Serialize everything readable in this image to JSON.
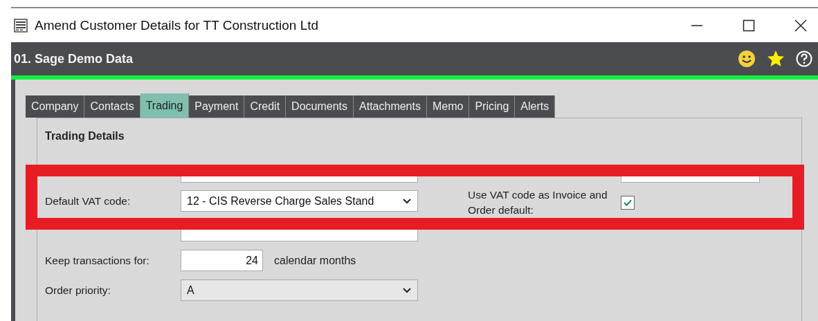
{
  "window": {
    "title": "Amend Customer Details for TT Construction Ltd"
  },
  "header": {
    "company": "01. Sage Demo Data"
  },
  "tabs": [
    {
      "label": "Company",
      "selected": false
    },
    {
      "label": "Contacts",
      "selected": false
    },
    {
      "label": "Trading",
      "selected": true
    },
    {
      "label": "Payment",
      "selected": false
    },
    {
      "label": "Credit",
      "selected": false
    },
    {
      "label": "Documents",
      "selected": false
    },
    {
      "label": "Attachments",
      "selected": false
    },
    {
      "label": "Memo",
      "selected": false
    },
    {
      "label": "Pricing",
      "selected": false
    },
    {
      "label": "Alerts",
      "selected": false
    }
  ],
  "section": {
    "title": "Trading Details"
  },
  "left_fields": [
    {
      "kind": "text"
    },
    {
      "kind": "dropdown",
      "label": "Default VAT code:",
      "value": "12 - CIS Reverse Charge Sales Stand"
    },
    {
      "kind": "text"
    },
    {
      "kind": "number",
      "label": "Keep transactions for:",
      "value": "24",
      "suffix": "calendar months"
    },
    {
      "kind": "dropdown",
      "label": "Order priority:",
      "value": "A"
    }
  ],
  "right_fields": [
    {
      "kind": "text"
    },
    {
      "kind": "checkbox",
      "label": "Use VAT code as Invoice and Order default:",
      "checked": true
    }
  ]
}
